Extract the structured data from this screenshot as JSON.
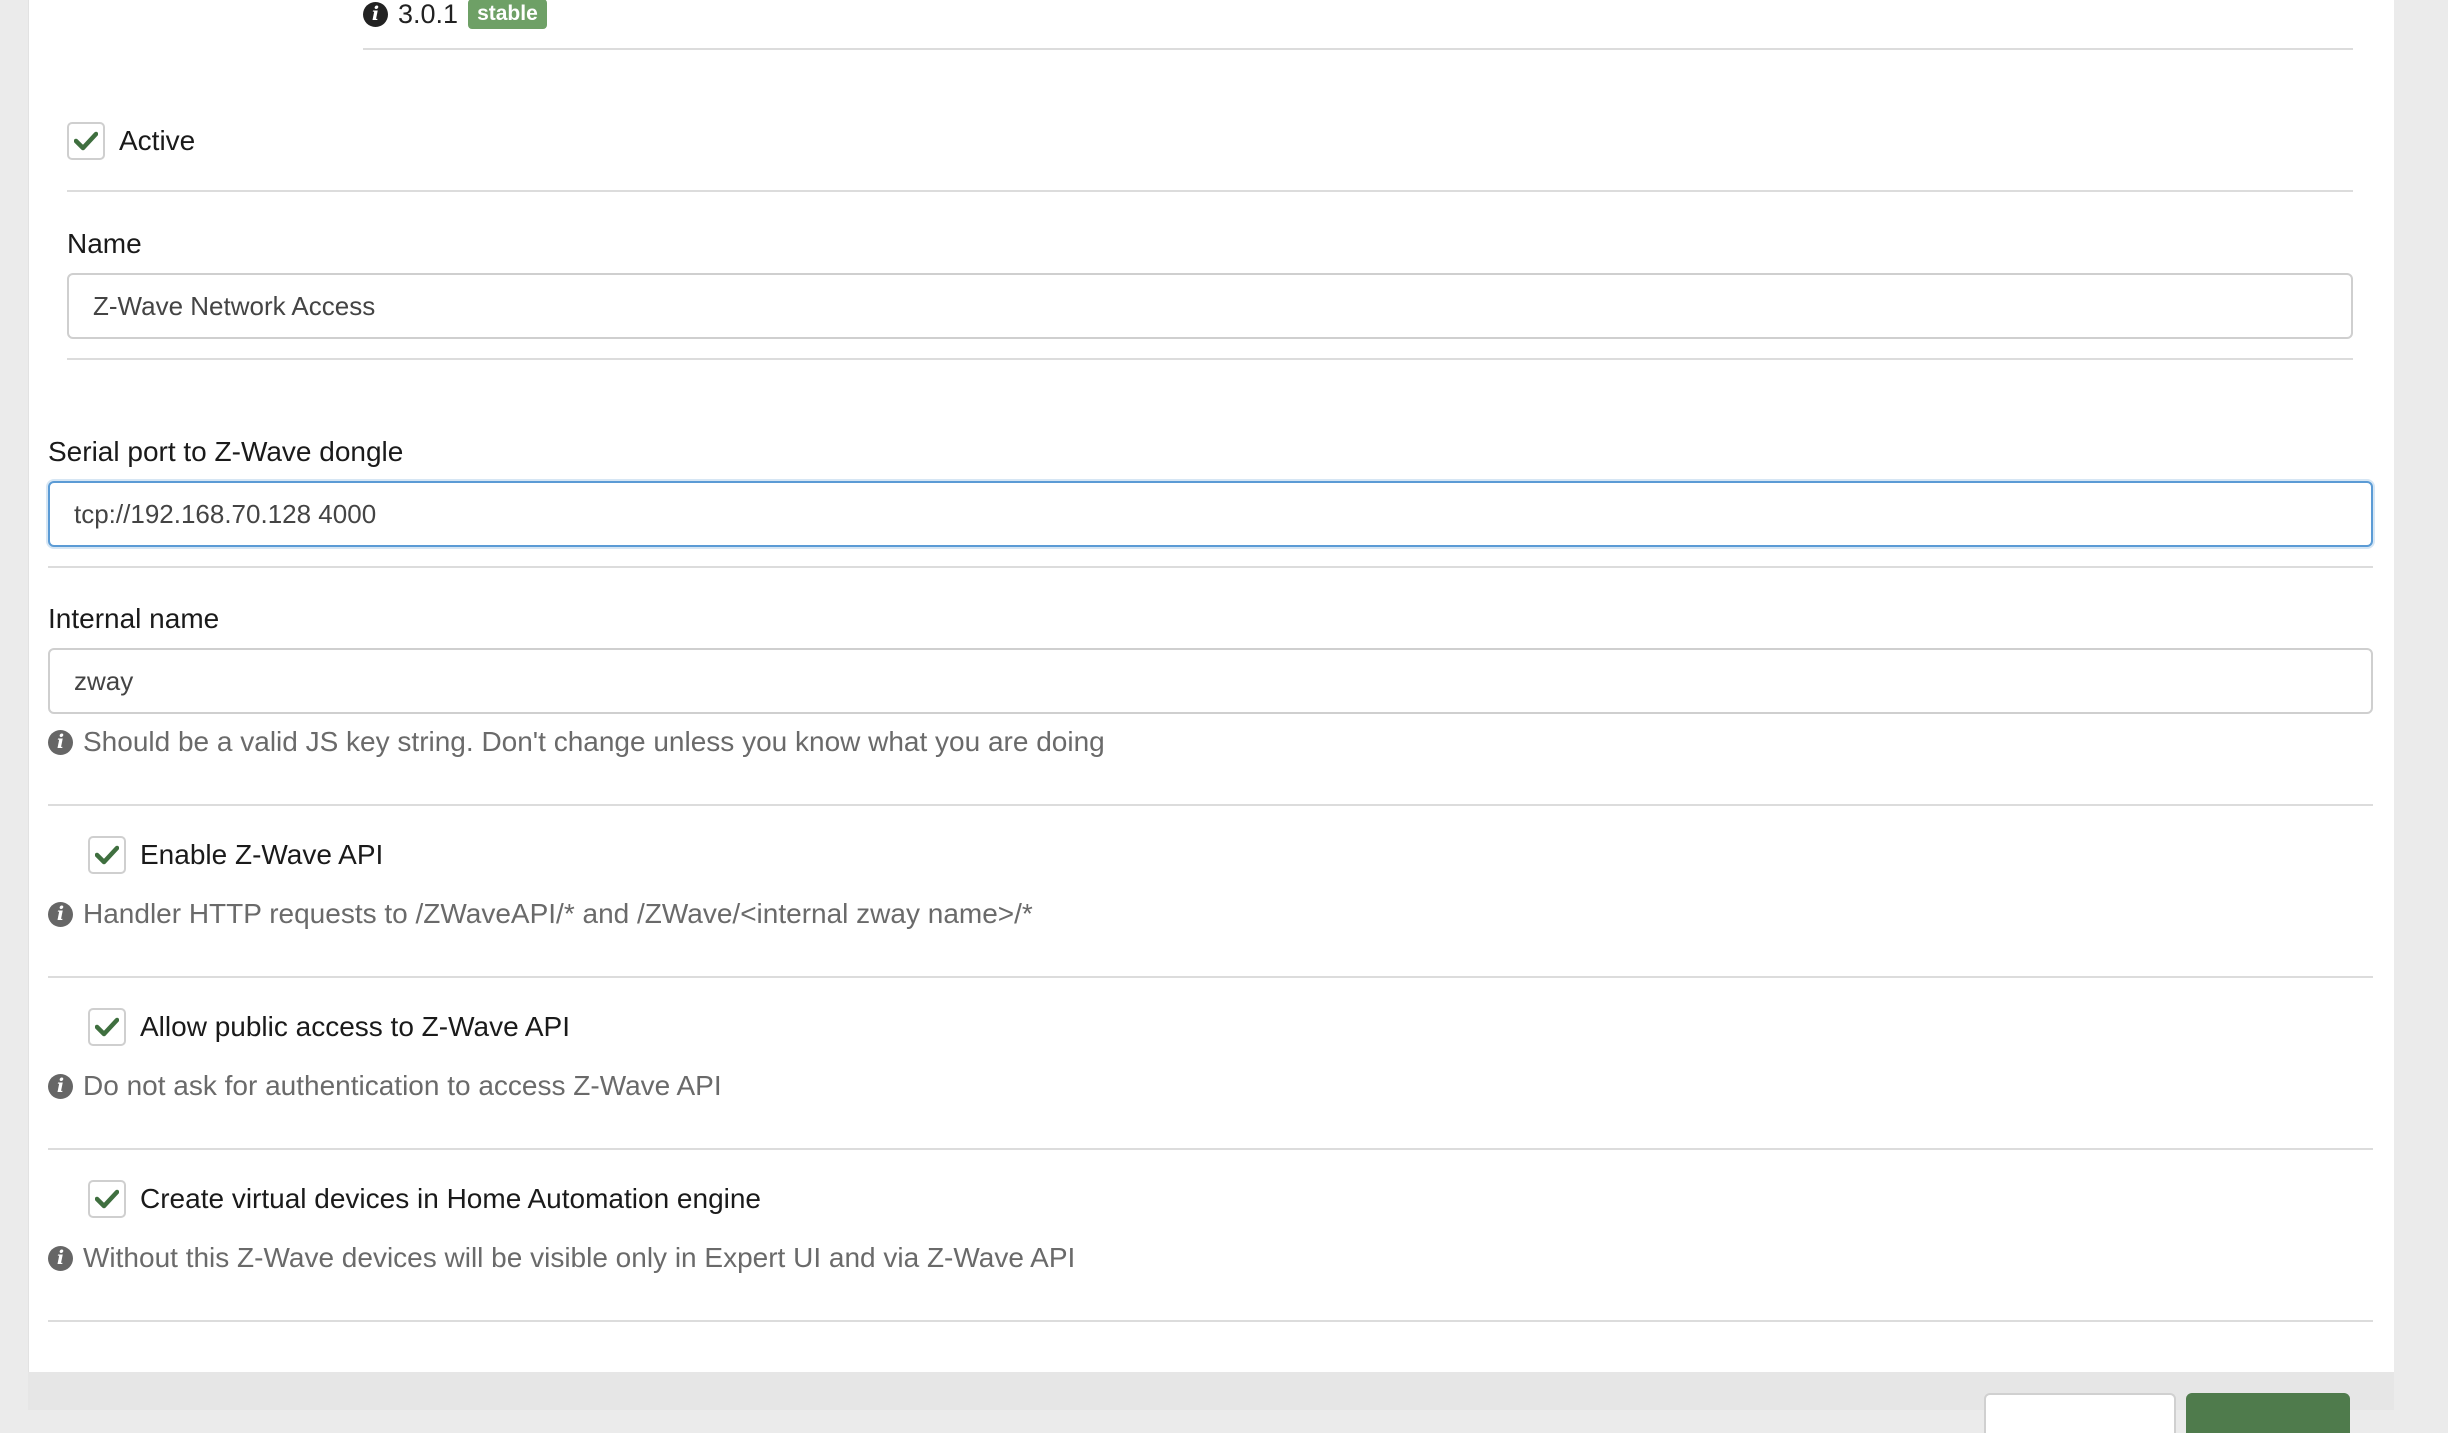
{
  "module": {
    "version": "3.0.1",
    "stability_badge": "stable"
  },
  "active": {
    "label": "Active",
    "checked": true
  },
  "name_field": {
    "label": "Name",
    "value": "Z-Wave Network Access"
  },
  "serial_port": {
    "label": "Serial port to Z-Wave dongle",
    "value": "tcp://192.168.70.128 4000"
  },
  "internal_name": {
    "label": "Internal name",
    "value": "zway",
    "help": "Should be a valid JS key string. Don't change unless you know what you are doing"
  },
  "enable_api": {
    "label": "Enable Z-Wave API",
    "checked": true,
    "help": "Handler HTTP requests to /ZWaveAPI/* and /ZWave/<internal zway name>/*"
  },
  "public_access": {
    "label": "Allow public access to Z-Wave API",
    "checked": true,
    "help": "Do not ask for authentication to access Z-Wave API"
  },
  "virtual_devices": {
    "label": "Create virtual devices in Home Automation engine",
    "checked": true,
    "help": "Without this Z-Wave devices will be visible only in Expert UI and via Z-Wave API"
  },
  "colors": {
    "accent_green": "#4f7b4c",
    "badge_green": "#6ea066",
    "focus_blue": "#5b9bd5"
  },
  "icons": {
    "info": "info-circle-icon",
    "check": "check-icon"
  }
}
